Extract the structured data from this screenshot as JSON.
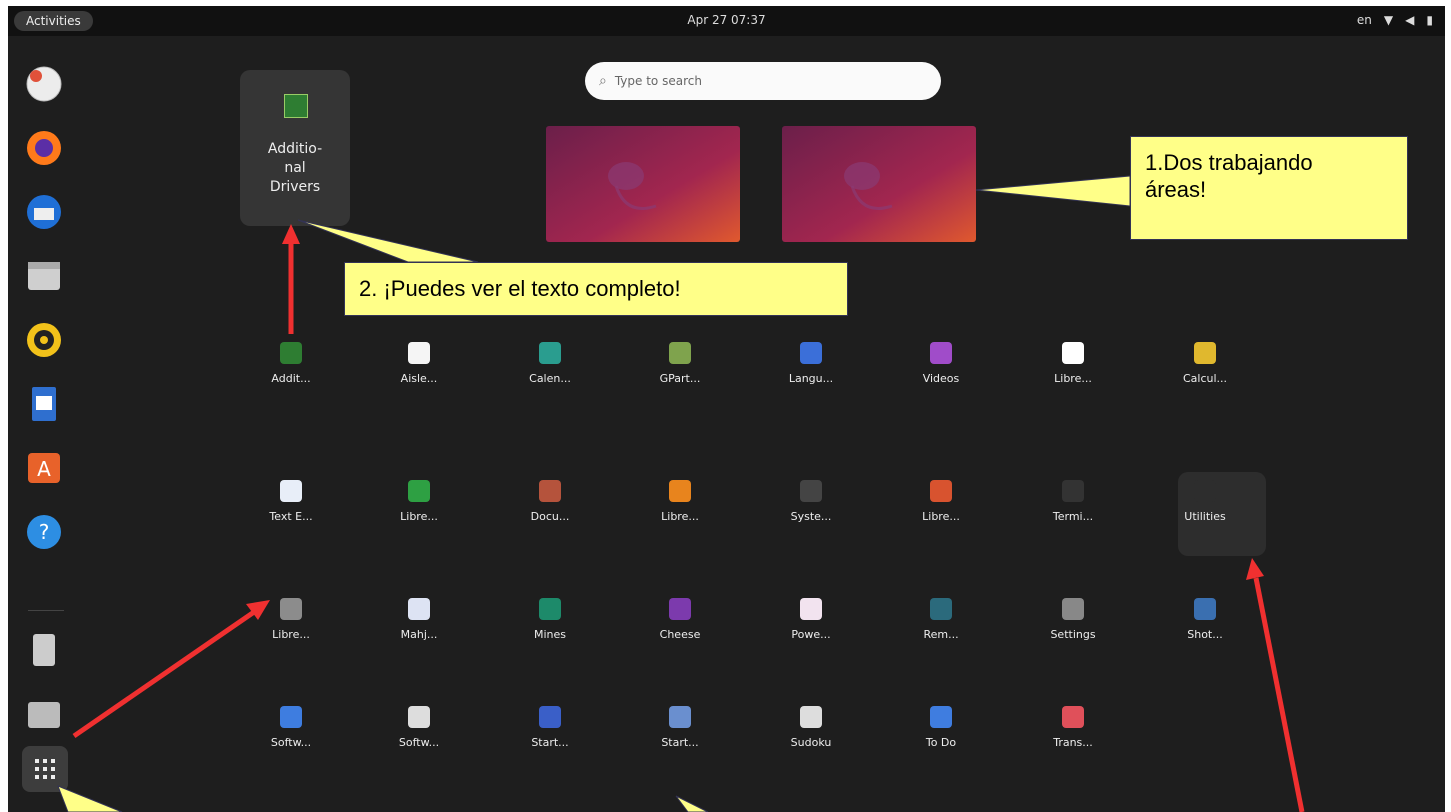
{
  "topbar": {
    "activities": "Activities",
    "clock": "Apr 27  07:37",
    "lang": "en"
  },
  "search": {
    "placeholder": "Type to search"
  },
  "folder": {
    "name_line1": "Additio-",
    "name_line2": "nal",
    "name_line3": "Drivers"
  },
  "apps": [
    {
      "label": "Addit...",
      "color": "#2e7d32"
    },
    {
      "label": "Aisle...",
      "color": "#f5f5f5"
    },
    {
      "label": "Calen...",
      "color": "#2a9d8f"
    },
    {
      "label": "GPart...",
      "color": "#7fa34d"
    },
    {
      "label": "Langu...",
      "color": "#3b6fd9"
    },
    {
      "label": "Videos",
      "color": "#a04cc9"
    },
    {
      "label": "Libre...",
      "color": "#ffffff"
    },
    {
      "label": "Calcul...",
      "color": "#e0b82e"
    },
    {
      "label": "Text E...",
      "color": "#e8eef8"
    },
    {
      "label": "Libre...",
      "color": "#2ea043"
    },
    {
      "label": "Docu...",
      "color": "#b5533c"
    },
    {
      "label": "Libre...",
      "color": "#e8841d"
    },
    {
      "label": "Syste...",
      "color": "#444444"
    },
    {
      "label": "Libre...",
      "color": "#d8532f"
    },
    {
      "label": "Termi...",
      "color": "#333333"
    },
    {
      "label": "Utilities",
      "color": "#2d2d2d"
    },
    {
      "label": "Libre...",
      "color": "#8c8c8c"
    },
    {
      "label": "Mahj...",
      "color": "#dde3f3"
    },
    {
      "label": "Mines",
      "color": "#1d8a6a"
    },
    {
      "label": "Cheese",
      "color": "#7c3aad"
    },
    {
      "label": "Powe...",
      "color": "#f2e3ef"
    },
    {
      "label": "Rem...",
      "color": "#2b6a7c"
    },
    {
      "label": "Settings",
      "color": "#888888"
    },
    {
      "label": "Shot...",
      "color": "#3a6fb0"
    },
    {
      "label": "Softw...",
      "color": "#3e7de0"
    },
    {
      "label": "Softw...",
      "color": "#dddddd"
    },
    {
      "label": "Start...",
      "color": "#3a5fc8"
    },
    {
      "label": "Start...",
      "color": "#6a8fcf"
    },
    {
      "label": "Sudoku",
      "color": "#dddddd"
    },
    {
      "label": "To Do",
      "color": "#3f7de0"
    },
    {
      "label": "Trans...",
      "color": "#e0505a"
    }
  ],
  "callouts": {
    "c1_line1": "1.Dos trabajando",
    "c1_line2": "áreas!",
    "c2": "2. ¡Puedes ver el texto completo!"
  },
  "colors": {
    "callout": "#ffff88",
    "arrow": "#f03030",
    "background": "#1e1e1e"
  }
}
